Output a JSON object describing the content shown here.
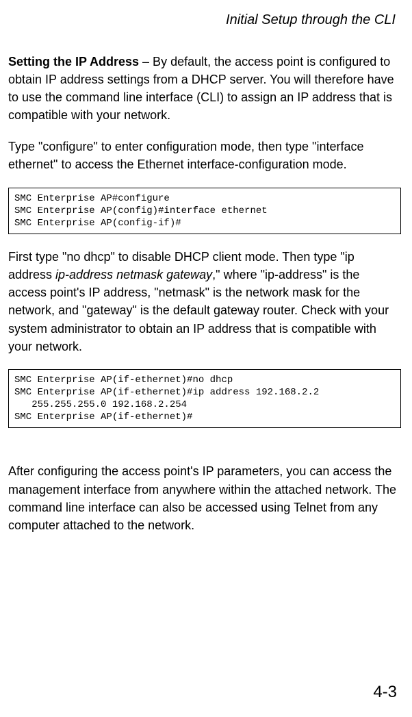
{
  "header": {
    "title": "Initial Setup through the CLI"
  },
  "body": {
    "p1_bold": "Setting the IP Address",
    "p1_rest": " – By default, the access point is configured to obtain IP address settings from a DHCP server. You will therefore have to use the command line interface (CLI) to assign an IP address that is compatible with your network.",
    "p2": "Type \"configure\" to enter configuration mode, then type \"interface ethernet\" to access the Ethernet interface-configuration mode.",
    "code1": "SMC Enterprise AP#configure\nSMC Enterprise AP(config)#interface ethernet\nSMC Enterprise AP(config-if)#",
    "p3a": "First type \"no dhcp\" to disable DHCP client mode. Then type \"ip address ",
    "p3_ital": "ip-address netmask gateway",
    "p3b": ",\" where \"ip-address\" is the access point's IP address, \"netmask\" is the network mask for the network, and \"gateway\" is the default gateway router. Check with your system administrator to obtain an IP address that is compatible with your network.",
    "code2": "SMC Enterprise AP(if-ethernet)#no dhcp\nSMC Enterprise AP(if-ethernet)#ip address 192.168.2.2 \n   255.255.255.0 192.168.2.254\nSMC Enterprise AP(if-ethernet)#",
    "p4": "After configuring the access point's IP parameters, you can access the management interface from anywhere within the attached network. The command line interface can also be accessed using Telnet from any computer attached to the network."
  },
  "footer": {
    "page": "4-3"
  }
}
